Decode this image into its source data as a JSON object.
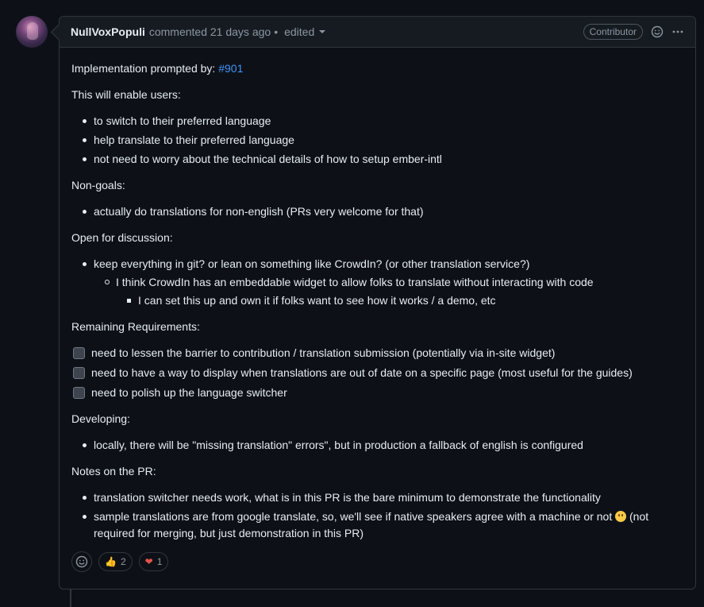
{
  "comment": {
    "author": "NullVoxPopuli",
    "meta": "commented 21 days ago",
    "separator": "•",
    "edited": "edited",
    "role_badge": "Contributor",
    "icons": {
      "react": "smiley-icon",
      "menu": "kebab-horizontal-icon"
    }
  },
  "body": {
    "intro_label": "Implementation prompted by:",
    "intro_link": "#901",
    "enable_heading": "This will enable users:",
    "enable_items": [
      "to switch to their preferred language",
      "help translate to their preferred language",
      "not need to worry about the technical details of how to setup ember-intl"
    ],
    "nongoals_heading": "Non-goals:",
    "nongoals_items": [
      "actually do translations for non-english (PRs very welcome for that)"
    ],
    "discussion_heading": "Open for discussion:",
    "discussion_item": "keep everything in git? or lean on something like CrowdIn? (or other translation service?)",
    "discussion_sub": "I think CrowdIn has an embeddable widget to allow folks to translate without interacting with code",
    "discussion_subsub": "I can set this up and own it if folks want to see how it works / a demo, etc",
    "requirements_heading": "Remaining Requirements:",
    "requirements_tasks": [
      "need to lessen the barrier to contribution / translation submission (potentially via in-site widget)",
      "need to have a way to display when translations are out of date on a specific page (most useful for the guides)",
      "need to polish up the language switcher"
    ],
    "developing_heading": "Developing:",
    "developing_items": [
      "locally, there will be \"missing translation\" errors\", but in production a fallback of english is configured"
    ],
    "notes_heading": "Notes on the PR:",
    "notes_item_1": "translation switcher needs work, what is in this PR is the bare minimum to demonstrate the functionality",
    "notes_item_2_before": "sample translations are from google translate, so, we'll see if native speakers agree with a machine or not",
    "notes_item_2_after": "(not required for merging, but just demonstration in this PR)"
  },
  "reactions": [
    {
      "emoji": "👍",
      "count": "2",
      "icon": "thumbs-up-icon"
    },
    {
      "emoji": "❤",
      "count": "1",
      "icon": "heart-icon"
    }
  ],
  "colors": {
    "background": "#0d1117",
    "header": "#161b22",
    "border": "#30363d",
    "link": "#4493f8",
    "muted": "#8d96a0"
  }
}
